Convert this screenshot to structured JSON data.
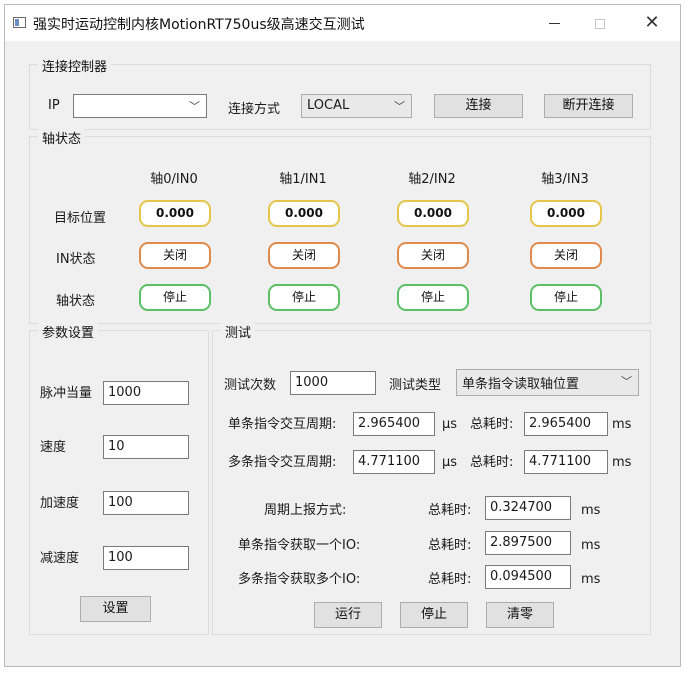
{
  "window": {
    "title": "强实时运动控制内核MotionRT750us级高速交互测试"
  },
  "connect": {
    "group_title": "连接控制器",
    "ip_label": "IP",
    "ip_value": "",
    "method_label": "连接方式",
    "method_value": "LOCAL",
    "connect_button": "连接",
    "disconnect_button": "断开连接"
  },
  "axis_status": {
    "group_title": "轴状态",
    "columns": [
      "轴0/IN0",
      "轴1/IN1",
      "轴2/IN2",
      "轴3/IN3"
    ],
    "rows": {
      "target_label": "目标位置",
      "in_label": "IN状态",
      "axis_label": "轴状态"
    },
    "target_values": [
      "0.000",
      "0.000",
      "0.000",
      "0.000"
    ],
    "in_values": [
      "关闭",
      "关闭",
      "关闭",
      "关闭"
    ],
    "axis_values": [
      "停止",
      "停止",
      "停止",
      "停止"
    ],
    "colors": {
      "target": "#e6c64a",
      "in": "#e08a4c",
      "axis": "#5cbf66"
    }
  },
  "params": {
    "group_title": "参数设置",
    "pulse_label": "脉冲当量",
    "pulse_value": "1000",
    "speed_label": "速度",
    "speed_value": "10",
    "accel_label": "加速度",
    "accel_value": "100",
    "decel_label": "减速度",
    "decel_value": "100",
    "set_button": "设置"
  },
  "test": {
    "group_title": "测试",
    "count_label": "测试次数",
    "count_value": "1000",
    "type_label": "测试类型",
    "type_value": "单条指令读取轴位置",
    "single_cycle_label": "单条指令交互周期:",
    "single_cycle_value": "2.965400",
    "single_cycle_unit": "μs",
    "single_total_label": "总耗时:",
    "single_total_value": "2.965400",
    "single_total_unit": "ms",
    "multi_cycle_label": "多条指令交互周期:",
    "multi_cycle_value": "4.771100",
    "multi_cycle_unit": "μs",
    "multi_total_label": "总耗时:",
    "multi_total_value": "4.771100",
    "multi_total_unit": "ms",
    "report_label": "周期上报方式:",
    "report_total_label": "总耗时:",
    "report_total_value": "0.324700",
    "report_unit": "ms",
    "single_io_label": "单条指令获取一个IO:",
    "single_io_total_label": "总耗时:",
    "single_io_total_value": "2.897500",
    "single_io_unit": "ms",
    "multi_io_label": "多条指令获取多个IO:",
    "multi_io_total_label": "总耗时:",
    "multi_io_total_value": "0.094500",
    "multi_io_unit": "ms",
    "run_button": "运行",
    "stop_button": "停止",
    "clear_button": "清零"
  }
}
